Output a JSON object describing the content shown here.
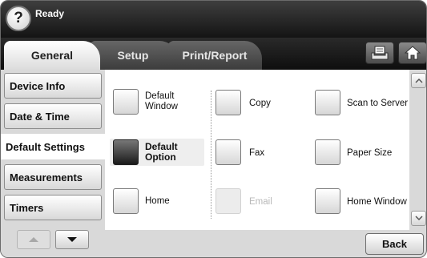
{
  "status": {
    "text": "Ready",
    "help_symbol": "?",
    "help_icon": "question-mark-icon"
  },
  "tabs": [
    {
      "label": "General",
      "active": true
    },
    {
      "label": "Setup",
      "active": false
    },
    {
      "label": "Print/Report",
      "active": false
    }
  ],
  "header_buttons": {
    "tray_icon": "paper-tray-icon",
    "home_icon": "home-icon"
  },
  "sidebar": {
    "items": [
      {
        "label": "Device Info",
        "selected": false
      },
      {
        "label": "Date & Time",
        "selected": false
      },
      {
        "label": "Default Settings",
        "selected": true
      },
      {
        "label": "Measurements",
        "selected": false
      },
      {
        "label": "Timers",
        "selected": false
      }
    ],
    "scroll_up_icon": "triangle-up-icon",
    "scroll_down_icon": "triangle-down-icon"
  },
  "options": {
    "default_window": "Default\nWindow",
    "default_option": "Default\nOption",
    "home": "Home",
    "copy": "Copy",
    "fax": "Fax",
    "email": "Email",
    "scan_to_server": "Scan to Server",
    "paper_size": "Paper Size",
    "home_window": "Home Window",
    "selected": "Default Option",
    "disabled": "Email"
  },
  "scroll": {
    "up_icon": "chevron-up-icon",
    "down_icon": "chevron-down-icon"
  },
  "footer": {
    "back_label": "Back"
  },
  "colors": {
    "header_dark": "#141414",
    "tab_active": "#ffffff",
    "panel_bg": "#d9d9d9",
    "selected_fill": "#1a1a1a"
  }
}
